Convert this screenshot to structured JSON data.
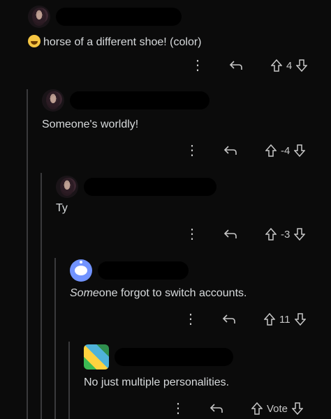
{
  "comments": [
    {
      "level": 0,
      "avatar": "user-photo",
      "body": "horse of a different shoe! (color)",
      "has_emoji": true,
      "emoji": "grinning-sweat-emoji",
      "score": "4"
    },
    {
      "level": 1,
      "avatar": "user-photo",
      "body": "Someone's worldly!",
      "has_emoji": false,
      "score": "-4"
    },
    {
      "level": 2,
      "avatar": "user-photo",
      "body": "Ty",
      "has_emoji": false,
      "score": "-3"
    },
    {
      "level": 3,
      "avatar": "snoo-default",
      "body_italic": "Some",
      "body_rest": "one forgot to switch accounts.",
      "has_emoji": false,
      "score": "11"
    },
    {
      "level": 4,
      "avatar": "pixel-avatar",
      "body": "No just multiple personalities.",
      "has_emoji": false,
      "score": "Vote"
    }
  ],
  "icons": {
    "more": "more-options-icon",
    "reply": "reply-icon",
    "up": "upvote-icon",
    "down": "downvote-icon"
  }
}
